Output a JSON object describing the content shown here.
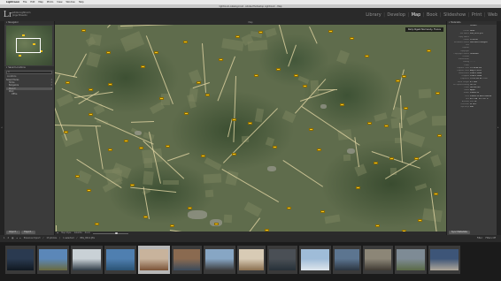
{
  "os_menubar": {
    "apple": "",
    "items": [
      "Lightroom",
      "File",
      "Edit",
      "Map",
      "Photo",
      "View",
      "Window",
      "Help"
    ],
    "right": [
      "⌃",
      "⌥",
      "⌘",
      "Q"
    ]
  },
  "window_title": "lightroom-catalog.lrcat - Adobe Photoshop Lightroom - Map",
  "identity_plate": {
    "logo": "Lr",
    "line1": "Adobe Lightroom",
    "line2": "Jorge Eduardo"
  },
  "modules": [
    {
      "label": "Library",
      "active": false
    },
    {
      "label": "Develop",
      "active": false
    },
    {
      "label": "Map",
      "active": true
    },
    {
      "label": "Book",
      "active": false
    },
    {
      "label": "Slideshow",
      "active": false
    },
    {
      "label": "Print",
      "active": false
    },
    {
      "label": "Web",
      "active": false
    }
  ],
  "left_panel": {
    "navigator_title": "Navigator",
    "saved_locations_title": "Saved Locations",
    "search_placeholder": "Q",
    "sub_label": "Locations",
    "locations": [
      {
        "label": "Saved Places",
        "count": "4",
        "indent": 0
      },
      {
        "label": "Home",
        "count": "2",
        "indent": 1
      },
      {
        "label": "Bangalore",
        "count": "0",
        "indent": 1
      },
      {
        "label": "Munich",
        "count": "5",
        "indent": 1
      },
      {
        "label": "Work",
        "count": "",
        "indent": 1
      },
      {
        "label": "Office",
        "count": "",
        "indent": 2
      }
    ],
    "import_btn": "Import...",
    "export_btn": "Export..."
  },
  "center": {
    "toolbar_label": "Map",
    "overlay_label": "Daily Digest Normandy, France",
    "bottom": {
      "map_style_label": "Map Style:",
      "map_style_value": "Satellite",
      "zoom_label": "Zoom",
      "lock_label": "◂▸"
    }
  },
  "right_panel": {
    "header": "Metadata",
    "section": "Default",
    "rows": [
      {
        "k": "Preset",
        "v": "None"
      },
      {
        "k": "File Name",
        "v": "IMG_0012.JPG"
      },
      {
        "k": "Copy Name",
        "v": ""
      },
      {
        "k": "Folder",
        "v": "2014-08"
      },
      {
        "k": "Metadata Status",
        "v": "Has been changed"
      },
      {
        "k": "Title",
        "v": ""
      },
      {
        "k": "Caption",
        "v": ""
      },
      {
        "k": "Copyright",
        "v": ""
      },
      {
        "k": "Copyright Status",
        "v": "Unknown"
      },
      {
        "k": "Creator",
        "v": ""
      },
      {
        "k": "Sublocation",
        "v": ""
      },
      {
        "k": "Rating",
        "v": "· · · · ·"
      },
      {
        "k": "Label",
        "v": ""
      },
      {
        "k": "Capture Time",
        "v": "12:14:48 PM"
      },
      {
        "k": "Capture Date",
        "v": "Aug 9, 2014"
      },
      {
        "k": "Dimensions",
        "v": "3264 x 2448"
      },
      {
        "k": "Cropped",
        "v": "3264 x 2448"
      },
      {
        "k": "Exposure",
        "v": "1/120 sec at f / 2.2"
      },
      {
        "k": "Focal Length",
        "v": "4.1 mm"
      },
      {
        "k": "ISO Speed Rating",
        "v": "ISO 32"
      },
      {
        "k": "Flash",
        "v": "Did not fire"
      },
      {
        "k": "Make",
        "v": "Apple"
      },
      {
        "k": "Model",
        "v": "iPhone 5s"
      },
      {
        "k": "Lens",
        "v": "iPhone 5s back camera"
      },
      {
        "k": "GPS",
        "v": "49°1'48\" N 1°9'6\" E"
      },
      {
        "k": "Altitude",
        "v": "72.7 m"
      },
      {
        "k": "Direction",
        "v": "W 283°"
      },
      {
        "k": "Gps Keys",
        "v": "Edit"
      }
    ],
    "sync_btn": "Sync Metadata"
  },
  "film_bar": {
    "left": [
      "1",
      "2",
      "▦",
      "◂",
      "▸",
      "Previous Import",
      "/",
      "13 photos",
      "/",
      "1 selected",
      "/",
      "IMG_0012.JPG"
    ],
    "right": [
      "Filter:",
      "Filters Off"
    ]
  },
  "filmstrip": {
    "thumbnails": [
      {
        "colors": [
          "#2a3a50",
          "#101820"
        ],
        "selected": false
      },
      {
        "colors": [
          "#5b87b8",
          "#6a6a3f"
        ],
        "selected": false
      },
      {
        "colors": [
          "#c9d1d6",
          "#2f3b45"
        ],
        "selected": false
      },
      {
        "colors": [
          "#4f7fb0",
          "#2a5273"
        ],
        "selected": false
      },
      {
        "colors": [
          "#c8b39c",
          "#7a5236"
        ],
        "selected": true
      },
      {
        "colors": [
          "#8a6a50",
          "#3a4a5b"
        ],
        "selected": false
      },
      {
        "colors": [
          "#87a6c4",
          "#3b3b3b"
        ],
        "selected": false
      },
      {
        "colors": [
          "#d8cbb5",
          "#8a6e4f"
        ],
        "selected": false
      },
      {
        "colors": [
          "#4a4f55",
          "#263038"
        ],
        "selected": false
      },
      {
        "colors": [
          "#9fbcd8",
          "#dfe6ec"
        ],
        "selected": false
      },
      {
        "colors": [
          "#5c7590",
          "#2b3540"
        ],
        "selected": false
      },
      {
        "colors": [
          "#8c8677",
          "#3f3a33"
        ],
        "selected": false
      },
      {
        "colors": [
          "#7e8b95",
          "#5a6a46"
        ],
        "selected": false
      },
      {
        "colors": [
          "#3d5578",
          "#b0a89a"
        ],
        "selected": false
      }
    ]
  }
}
